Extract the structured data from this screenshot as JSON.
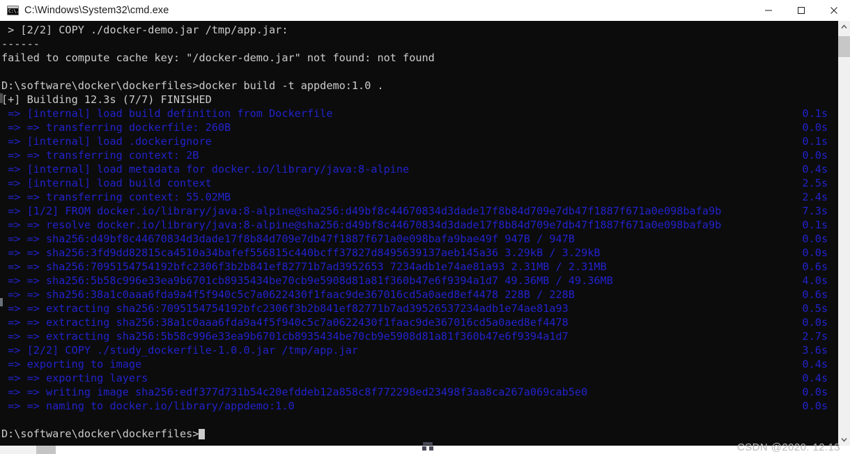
{
  "window": {
    "title": "C:\\Windows\\System32\\cmd.exe",
    "icon": "cmd-console-icon",
    "icon_glyph": "C:\\.",
    "controls": {
      "minimize_label": "Minimize",
      "maximize_label": "Maximize",
      "close_label": "Close"
    }
  },
  "console": {
    "background_color": "#0c0c0c",
    "default_text_color": "#cccccc",
    "accent_text_color": "#2222cc",
    "prompt_path": "D:\\software\\docker\\dockerfiles>",
    "lines": [
      {
        "text": " > [2/2] COPY ./docker-demo.jar /tmp/app.jar:",
        "color": "white",
        "dur": ""
      },
      {
        "text": "------",
        "color": "white",
        "dur": ""
      },
      {
        "text": "failed to compute cache key: \"/docker-demo.jar\" not found: not found",
        "color": "white",
        "dur": ""
      },
      {
        "text": "",
        "color": "white",
        "dur": ""
      },
      {
        "text": "D:\\software\\docker\\dockerfiles>docker build -t appdemo:1.0 .",
        "color": "white",
        "dur": ""
      },
      {
        "text": "[+] Building 12.3s (7/7) FINISHED",
        "color": "white",
        "dur": ""
      },
      {
        "text": " => [internal] load build definition from Dockerfile",
        "color": "blue",
        "dur": "0.1s"
      },
      {
        "text": " => => transferring dockerfile: 260B",
        "color": "blue",
        "dur": "0.0s"
      },
      {
        "text": " => [internal] load .dockerignore",
        "color": "blue",
        "dur": "0.1s"
      },
      {
        "text": " => => transferring context: 2B",
        "color": "blue",
        "dur": "0.0s"
      },
      {
        "text": " => [internal] load metadata for docker.io/library/java:8-alpine",
        "color": "blue",
        "dur": "0.4s"
      },
      {
        "text": " => [internal] load build context",
        "color": "blue",
        "dur": "2.5s"
      },
      {
        "text": " => => transferring context: 55.02MB",
        "color": "blue",
        "dur": "2.4s"
      },
      {
        "text": " => [1/2] FROM docker.io/library/java:8-alpine@sha256:d49bf8c44670834d3dade17f8b84d709e7db47f1887f671a0e098bafa9b",
        "color": "blue",
        "dur": "7.3s"
      },
      {
        "text": " => => resolve docker.io/library/java:8-alpine@sha256:d49bf8c44670834d3dade17f8b84d709e7db47f1887f671a0e098bafa9b",
        "color": "blue",
        "dur": "0.1s"
      },
      {
        "text": " => => sha256:d49bf8c44670834d3dade17f8b84d709e7db47f1887f671a0e098bafa9bae49f 947B / 947B",
        "color": "blue",
        "dur": "0.0s"
      },
      {
        "text": " => => sha256:3fd9dd82815ca4510a34bafef556815c440bcff37827d8495639137aeb145a36 3.29kB / 3.29kB",
        "color": "blue",
        "dur": "0.0s"
      },
      {
        "text": " => => sha256:7095154754192bfc2306f3b2b841ef82771b7ad3952653 7234adb1e74ae81a93 2.31MB / 2.31MB",
        "color": "blue",
        "dur": "0.6s"
      },
      {
        "text": " => => sha256:5b58c996e33ea9b6701cb8935434be70cb9e5908d81a81f360b47e6f9394a1d7 49.36MB / 49.36MB",
        "color": "blue",
        "dur": "4.0s"
      },
      {
        "text": " => => sha256:38a1c0aaa6fda9a4f5f940c5c7a0622430f1faac9de367016cd5a0aed8ef4478 228B / 228B",
        "color": "blue",
        "dur": "0.6s"
      },
      {
        "text": " => => extracting sha256:7095154754192bfc2306f3b2b841ef82771b7ad39526537234adb1e74ae81a93",
        "color": "blue",
        "dur": "0.5s"
      },
      {
        "text": " => => extracting sha256:38a1c0aaa6fda9a4f5f940c5c7a0622430f1faac9de367016cd5a0aed8ef4478",
        "color": "blue",
        "dur": "0.0s"
      },
      {
        "text": " => => extracting sha256:5b58c996e33ea9b6701cb8935434be70cb9e5908d81a81f360b47e6f9394a1d7",
        "color": "blue",
        "dur": "2.7s"
      },
      {
        "text": " => [2/2] COPY ./study_dockerfile-1.0.0.jar /tmp/app.jar",
        "color": "blue",
        "dur": "3.6s"
      },
      {
        "text": " => exporting to image",
        "color": "blue",
        "dur": "0.4s"
      },
      {
        "text": " => => exporting layers",
        "color": "blue",
        "dur": "0.4s"
      },
      {
        "text": " => => writing image sha256:edf377d731b54c20efddeb12a858c8f772298ed23498f3aa8ca267a069cab5e0",
        "color": "blue",
        "dur": "0.0s"
      },
      {
        "text": " => => naming to docker.io/library/appdemo:1.0",
        "color": "blue",
        "dur": "0.0s"
      },
      {
        "text": "",
        "color": "white",
        "dur": ""
      },
      {
        "text": "D:\\software\\docker\\dockerfiles>",
        "color": "white",
        "dur": "",
        "cursor": true
      }
    ]
  },
  "scrollbar": {
    "up_arrow": "chevron-up-icon",
    "down_arrow": "chevron-down-icon",
    "thumb_position_percent": 1
  },
  "taskbar": {
    "pinned_icon": "app-tray-icon"
  },
  "watermark": {
    "text": "CSDN @2020. 12.13"
  }
}
